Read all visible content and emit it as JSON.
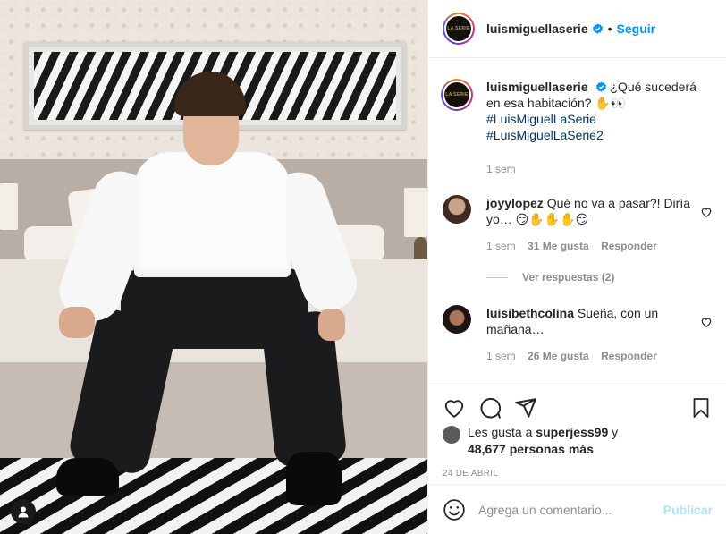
{
  "post": {
    "username": "luismiguellaserie",
    "follow_label": "Seguir",
    "dot": "•",
    "avatar_text": "LA SERIE",
    "caption": "¿Qué sucederá en esa habitación? ✋👀",
    "hashtags": [
      "#LuisMiguelLaSerie",
      "#LuisMiguelLaSerie2"
    ],
    "caption_time": "1 sem"
  },
  "comments": [
    {
      "username": "joyylopez",
      "text": "Qué no va a pasar?! Diría yo… 😏✋✋✋😏",
      "time": "1 sem",
      "likes": "31 Me gusta",
      "reply_label": "Responder",
      "view_replies": "Ver respuestas (2)"
    },
    {
      "username": "luisibethcolina",
      "text": "Sueña, con un mañana…",
      "time": "1 sem",
      "likes": "26 Me gusta",
      "reply_label": "Responder"
    }
  ],
  "likes_summary": {
    "prefix": "Les gusta a",
    "user": "superjess99",
    "suffix": "y",
    "others": "48,677 personas más"
  },
  "date": "24 DE ABRIL",
  "comment_box": {
    "placeholder": "Agrega un comentario...",
    "post_label": "Publicar"
  },
  "icons": {
    "like": "heart-icon",
    "comment": "comment-bubble-icon",
    "share": "paper-plane-icon",
    "save": "bookmark-icon",
    "emoji": "smiley-icon",
    "verified": "verified-badge-icon",
    "tag": "user-tag-icon"
  },
  "colors": {
    "link_blue": "#0095f6",
    "hashtag_blue": "#00376b",
    "muted_gray": "#8e8e8e",
    "publish_disabled": "#b2dffc"
  }
}
